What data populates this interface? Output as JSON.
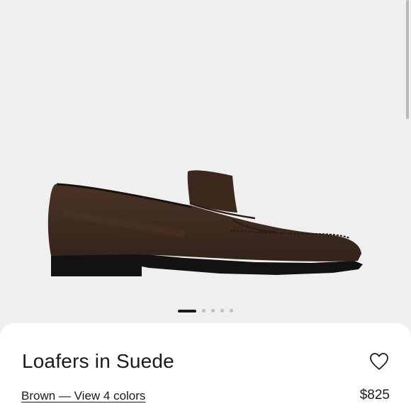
{
  "product": {
    "title": "Loafers in Suede",
    "color_link": "Brown — View 4 colors",
    "price": "$825",
    "image_icon": "brown-suede-loafer"
  },
  "carousel": {
    "total": 5,
    "active": 1
  },
  "icons": {
    "favorite": "heart-outline-icon"
  },
  "colors": {
    "background": "#efefef",
    "sheet": "#ffffff",
    "text": "#1a1a1a",
    "shoe": "#3f2a1e"
  }
}
